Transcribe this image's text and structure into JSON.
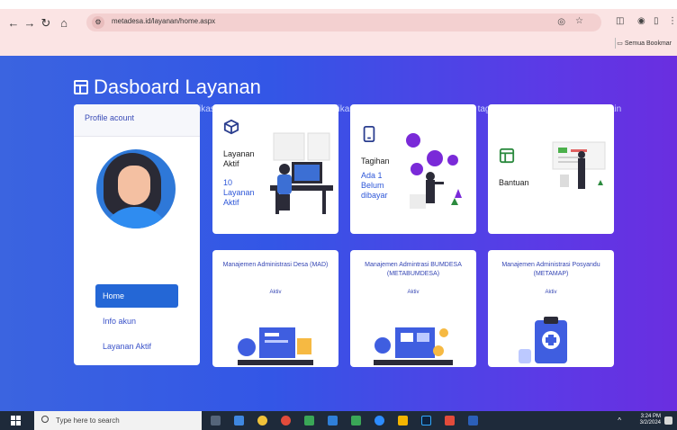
{
  "browser": {
    "url": "metadesa.id/layanan/home.aspx",
    "bookmarks_label": "Semua Bookmar"
  },
  "hero": {
    "title": "Dasboard Layanan",
    "description": "Dashboard Layanan adalah aplikasi sistem informasi yang menyajikan informasi mengenai Layanan, tagihan, informasi akun dan lain lain"
  },
  "profile": {
    "header": "Profile acount",
    "menu": [
      {
        "label": "Home"
      },
      {
        "label": "Info akun"
      },
      {
        "label": "Layanan Aktif"
      }
    ]
  },
  "cards": {
    "layanan": {
      "title": "Layanan Aktif",
      "sub": "10 Layanan Aktif"
    },
    "tagihan": {
      "title": "Tagihan",
      "sub": "Ada 1 Belum dibayar"
    },
    "bantuan": {
      "title": "Bantuan"
    }
  },
  "modules": [
    {
      "title": "Manajemen Administrasi Desa (MAD)",
      "status": "Aktiv"
    },
    {
      "title": "Manajemen Admintrasi BUMDESA (METABUMDESA)",
      "status": "Aktiv"
    },
    {
      "title": "Manajemen Administrasi Posyandu (METAMAP)",
      "status": "Aktiv"
    }
  ],
  "taskbar": {
    "search_placeholder": "Type here to search",
    "time": "3:24 PM",
    "date": "3/2/2024"
  },
  "colors": {
    "accent": "#2467d6",
    "hero_start": "#3b64e0",
    "hero_end": "#6a2ee0"
  }
}
